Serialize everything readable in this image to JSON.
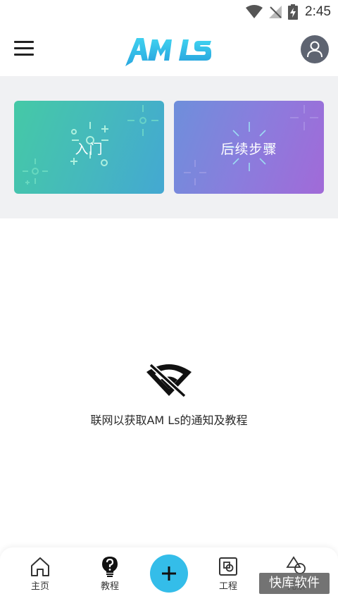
{
  "status_bar": {
    "time": "2:45",
    "icons": [
      "wifi-icon",
      "no-signal-icon",
      "battery-charging-icon"
    ]
  },
  "app_bar": {
    "logo_text": "AM Ls",
    "menu_icon": "menu-icon",
    "avatar_icon": "user-icon"
  },
  "banners": [
    {
      "label": "入门"
    },
    {
      "label": "后续步骤"
    }
  ],
  "empty_state": {
    "icon": "wifi-off-icon",
    "message": "联网以获取AM Ls的通知及教程"
  },
  "bottom_nav": {
    "items": [
      {
        "label": "主页",
        "icon": "home-icon"
      },
      {
        "label": "教程",
        "icon": "help-bulb-icon"
      },
      {
        "label": "",
        "icon": "plus-icon"
      },
      {
        "label": "工程",
        "icon": "project-icon"
      },
      {
        "label": "元素",
        "icon": "shapes-icon"
      }
    ]
  },
  "watermark": "快库软件",
  "colors": {
    "accent_blue": "#34bde9",
    "card_intro_start": "#45c9a6",
    "card_intro_end": "#44a8d2",
    "card_next_start": "#6e8fdb",
    "card_next_end": "#a16ad8",
    "avatar_bg": "#5e6471"
  }
}
